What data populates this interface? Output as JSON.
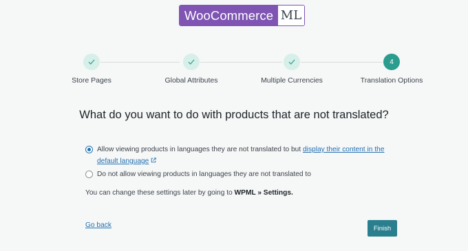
{
  "logo": {
    "brand": "WooCommerce",
    "suffix": "ML"
  },
  "steps": [
    {
      "label": "Store Pages",
      "status": "done"
    },
    {
      "label": "Global Attributes",
      "status": "done"
    },
    {
      "label": "Multiple Currencies",
      "status": "done"
    },
    {
      "label": "Translation Options",
      "status": "active",
      "number": "4"
    }
  ],
  "heading": "What do you want to do with products that are not translated?",
  "options": [
    {
      "text": "Allow viewing products in languages they are not translated to but ",
      "link": "display their content in the default language",
      "link_icon": "external-link-icon",
      "selected": true
    },
    {
      "text": "Do not allow viewing products in languages they are not translated to",
      "selected": false
    }
  ],
  "note": {
    "text": "You can change these settings later by going to ",
    "bold": "WPML » Settings."
  },
  "actions": {
    "back_label": "Go back",
    "finish_label": "Finish"
  },
  "colors": {
    "brand_purple": "#7f54b3",
    "accent_teal": "#2a9d8f",
    "link_blue": "#2271b1",
    "finish_button": "#2a7f8f"
  }
}
